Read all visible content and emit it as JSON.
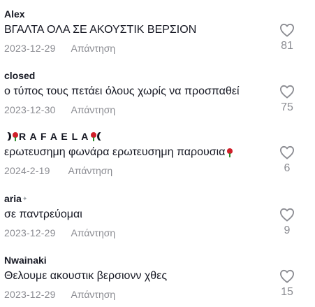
{
  "comments": [
    {
      "username": "Alex",
      "text": "ΒΓΑΛΤΑ ΟΛΑ ΣΕ ΑΚΟΥΣΤΙΚ ΒΕΡΣΙΟΝ",
      "date": "2023-12-29",
      "reply_label": "Απάντηση",
      "likes": "81"
    },
    {
      "username": "closed",
      "text": "ο τύπος τους πετάει όλους χωρίς να προσπαθεί",
      "date": "2023-12-30",
      "reply_label": "Απάντηση",
      "likes": "75"
    },
    {
      "username": "RAFAELA",
      "username_display": "R A F A E L A",
      "text": "ερωτευσημη φωνάρα ερωτευσημη παρουσια",
      "date": "2024-2-19",
      "reply_label": "Απάντηση",
      "likes": "6"
    },
    {
      "username": "aria",
      "text": "σε παντρεύομαι",
      "date": "2023-12-29",
      "reply_label": "Απάντηση",
      "likes": "9"
    },
    {
      "username": "Nwainaki",
      "text": "Θελουμε ακουστικ βερσιονν χθες",
      "date": "2023-12-29",
      "reply_label": "Απάντηση",
      "likes": "15"
    }
  ],
  "icons": {
    "like": "heart-outline-icon",
    "decoration": "rose-icon"
  },
  "colors": {
    "text_primary": "#161823",
    "text_secondary": "#8a8b91",
    "rose": "#d0202a"
  }
}
